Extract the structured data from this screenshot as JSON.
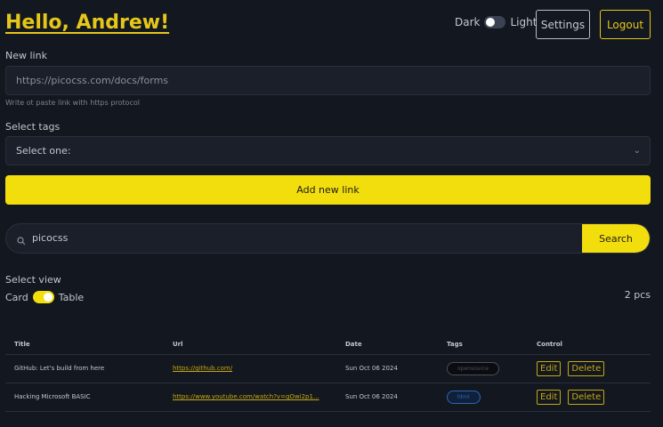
{
  "header": {
    "greeting": "Hello, Andrew!",
    "theme_dark_label": "Dark",
    "theme_light_label": "Light",
    "settings_label": "Settings",
    "logout_label": "Logout"
  },
  "form": {
    "new_link_label": "New link",
    "new_link_value": "https://picocss.com/docs/forms",
    "new_link_helper": "Write ot paste link with https protocol",
    "tags_label": "Select tags",
    "tags_selected": "Select one:",
    "add_button_label": "Add new link"
  },
  "search": {
    "value": "picocss",
    "button_label": "Search"
  },
  "view": {
    "label": "Select view",
    "card_label": "Card",
    "table_label": "Table",
    "count": "2 pcs"
  },
  "table": {
    "headers": {
      "title": "Title",
      "url": "Url",
      "date": "Date",
      "tags": "Tags",
      "control": "Control"
    },
    "rows": [
      {
        "title": "GitHub: Let's build from here",
        "url": "https://github.com/",
        "date": "Sun Oct 06 2024",
        "tag": "opensource",
        "edit": "Edit",
        "delete": "Delete"
      },
      {
        "title": "Hacking Microsoft BASIC",
        "url": "https://www.youtube.com/watch?v=gOwi2p1...",
        "date": "Sun Oct 06 2024",
        "tag": "html",
        "edit": "Edit",
        "delete": "Delete"
      }
    ]
  },
  "colors": {
    "accent": "#f2de0d",
    "background": "#13171f"
  }
}
